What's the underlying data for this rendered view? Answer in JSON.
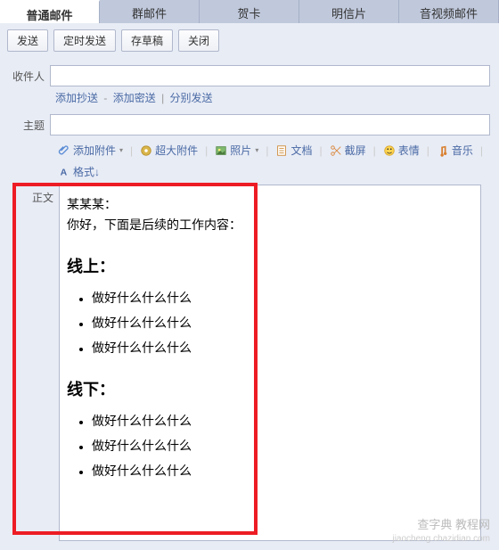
{
  "tabs": {
    "items": [
      {
        "label": "普通邮件",
        "active": true
      },
      {
        "label": "群邮件",
        "active": false
      },
      {
        "label": "贺卡",
        "active": false
      },
      {
        "label": "明信片",
        "active": false
      },
      {
        "label": "音视频邮件",
        "active": false
      }
    ]
  },
  "buttons": {
    "send": "发送",
    "timed_send": "定时发送",
    "save_draft": "存草稿",
    "close": "关闭"
  },
  "form": {
    "recipient_label": "收件人",
    "recipient_value": "",
    "subject_label": "主题",
    "subject_value": "",
    "body_label": "正文"
  },
  "links": {
    "add_cc": "添加抄送",
    "add_bcc": "添加密送",
    "send_separately": "分别发送"
  },
  "toolbar": {
    "attachment": "添加附件",
    "large_attach": "超大附件",
    "photo": "照片",
    "doc": "文档",
    "screenshot": "截屏",
    "emoji": "表情",
    "music": "音乐",
    "format": "格式↓"
  },
  "body": {
    "greeting_name": "某某某：",
    "greeting_text": "你好，下面是后续的工作内容：",
    "section1_title": "线上：",
    "section1_items": [
      "做好什么什么什么",
      "做好什么什么什么",
      "做好什么什么什么"
    ],
    "section2_title": "线下：",
    "section2_items": [
      "做好什么什么什么",
      "做好什么什么什么",
      "做好什么什么什么"
    ]
  },
  "watermark": {
    "line1": "查字典 教程网",
    "line2": "jiaocheng.chazidian.com"
  },
  "colors": {
    "accent": "#c0c9dc",
    "link": "#4a6aa5",
    "highlight_border": "#ed1c24"
  }
}
